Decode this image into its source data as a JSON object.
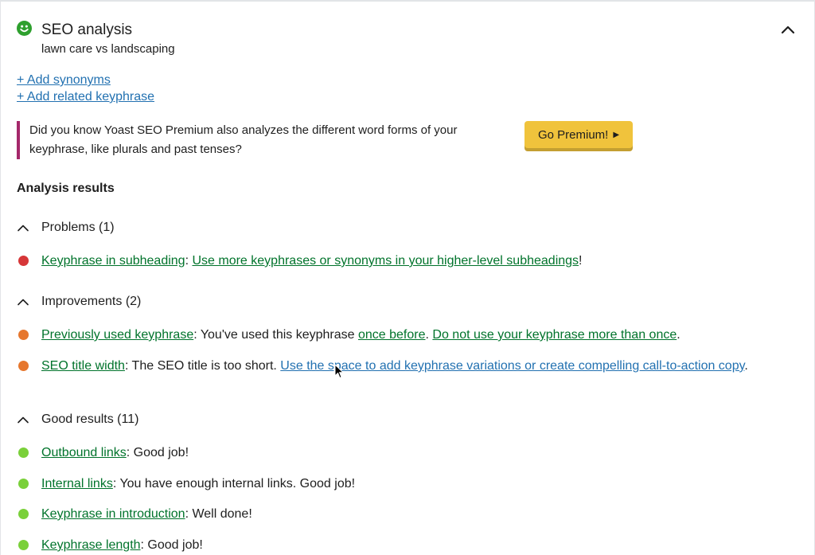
{
  "colors": {
    "problem": "#d63638",
    "improvement": "#e6772e",
    "good": "#7ad03a",
    "smiley": "#2ea02e",
    "premium_button": "#f0c33c",
    "promo_border": "#a4286a",
    "link_green": "#00732b",
    "link_blue": "#2271b1"
  },
  "header": {
    "icon": "smiley-face-icon",
    "title": "SEO analysis",
    "keyphrase": "lawn care vs landscaping",
    "collapse_icon": "chevron-up-icon"
  },
  "links": {
    "add_synonyms": "+ Add synonyms",
    "add_related": "+ Add related keyphrase"
  },
  "promo": {
    "text": "Did you know Yoast SEO Premium also analyzes the different word forms of your keyphrase, like plurals and past tenses?",
    "button_label": "Go Premium!",
    "button_icon": "triangle-right-icon"
  },
  "analysis": {
    "title": "Analysis results",
    "groups": {
      "problems": {
        "title": "Problems (1)",
        "items": [
          {
            "link": "Keyphrase in subheading",
            "sep": ": ",
            "action": "Use more keyphrases or synonyms in your higher-level subheadings",
            "end": "!"
          }
        ]
      },
      "improvements": {
        "title": "Improvements (2)",
        "items": [
          {
            "link": "Previously used keyphrase",
            "sep": ": ",
            "text": "You've used this keyphrase ",
            "link2": "once before",
            "mid": ". ",
            "action": "Do not use your keyphrase more than once",
            "end": "."
          },
          {
            "link": "SEO title width",
            "sep": ": ",
            "text": "The SEO title is too short. ",
            "action": "Use the space to add keyphrase variations or create compelling call-to-action copy",
            "end": "."
          }
        ]
      },
      "good": {
        "title": "Good results (11)",
        "items": [
          {
            "link": "Outbound links",
            "sep": ": ",
            "text": "Good job!"
          },
          {
            "link": "Internal links",
            "sep": ": ",
            "text": "You have enough internal links. Good job!"
          },
          {
            "link": "Keyphrase in introduction",
            "sep": ": ",
            "text": "Well done!"
          },
          {
            "link": "Keyphrase length",
            "sep": ": ",
            "text": "Good job!"
          }
        ]
      }
    }
  }
}
